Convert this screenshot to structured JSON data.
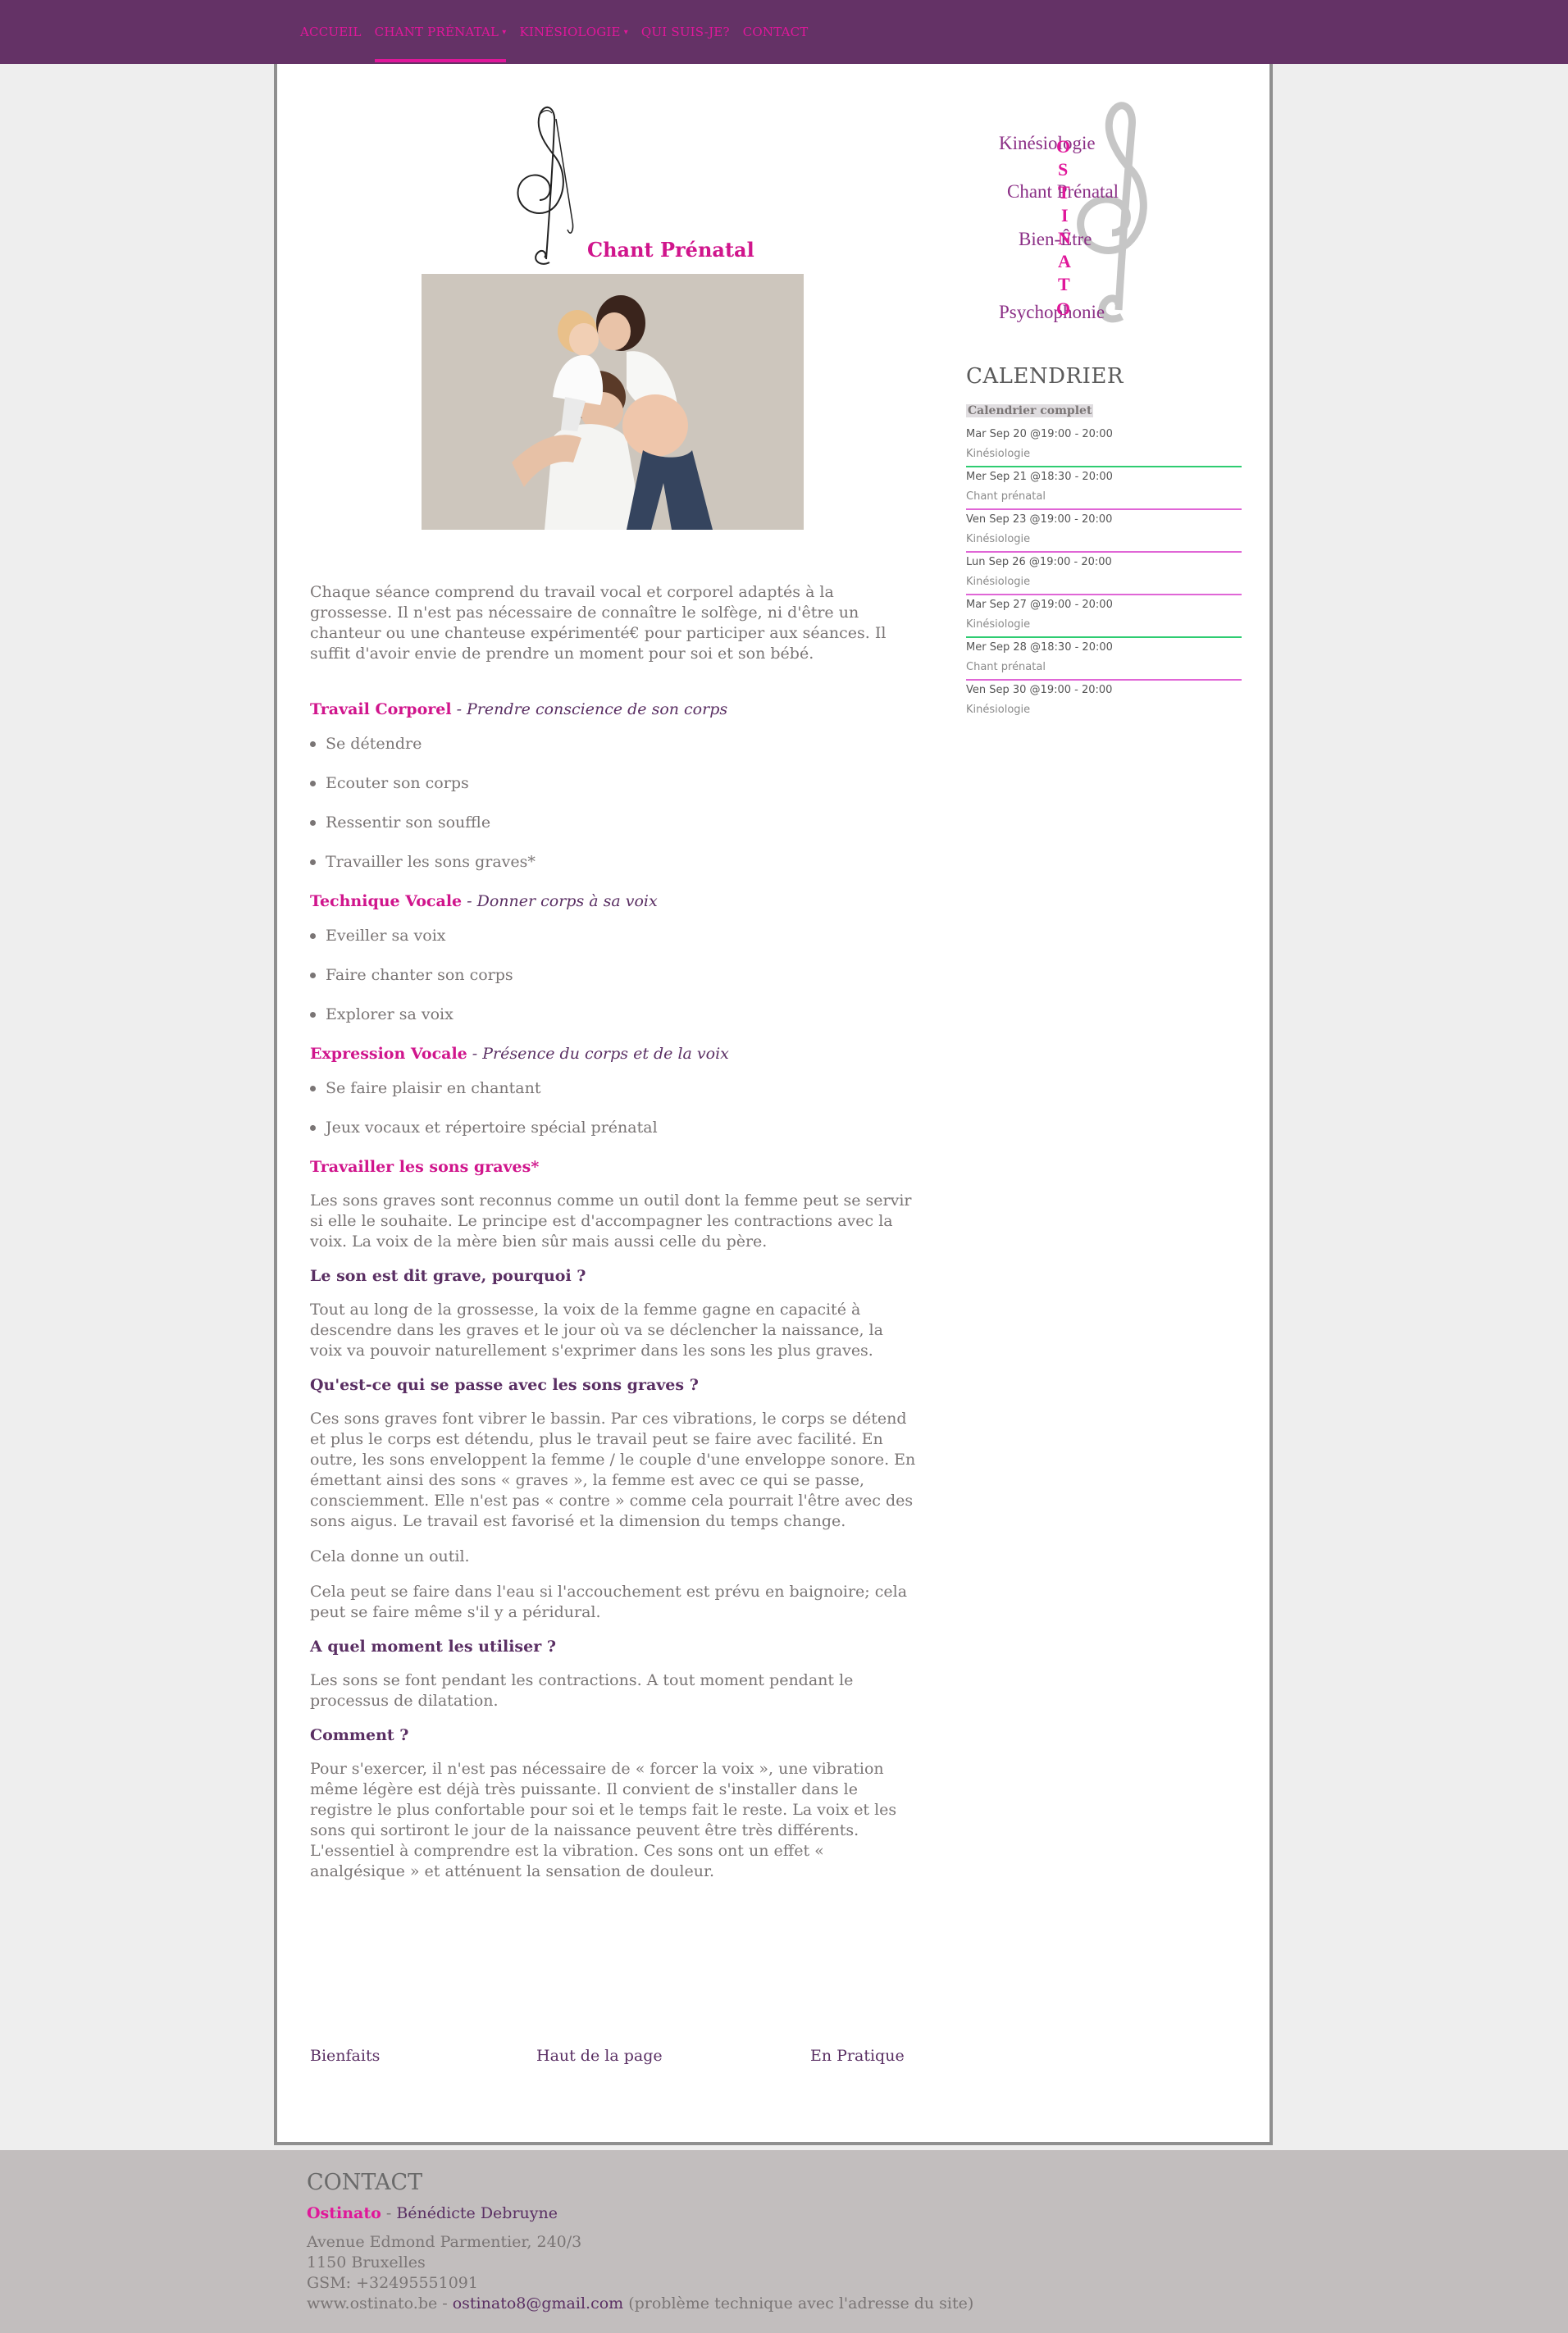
{
  "nav": {
    "items": [
      {
        "label": "Accueil"
      },
      {
        "label": "Chant Prénatal"
      },
      {
        "label": "Kinésiologie"
      },
      {
        "label": "Qui suis-je?"
      },
      {
        "label": "Contact"
      }
    ]
  },
  "hero": {
    "title": "Chant Prénatal"
  },
  "intro": "Chaque séance comprend du travail vocal et corporel adaptés à la grossesse. Il n'est pas nécessaire de connaître le solfège, ni d'être un chanteur ou une chanteuse expérimenté€ pour participer aux séances. Il suffit d'avoir envie de prendre un moment pour soi et son bébé.",
  "sections": [
    {
      "title": "Travail Corporel",
      "subtitle": " - Prendre conscience de son corps",
      "items": [
        "Se détendre",
        "Ecouter son corps",
        "Ressentir son souffle",
        "Travailler les sons graves*"
      ]
    },
    {
      "title": "Technique Vocale",
      "subtitle": " - Donner corps à sa voix",
      "items": [
        "Eveiller sa voix",
        "Faire chanter son corps",
        "Explorer sa voix"
      ]
    },
    {
      "title": "Expression Vocale",
      "subtitle": " - Présence du corps et de la voix",
      "items": [
        "Se faire plaisir en chantant",
        "Jeux vocaux et répertoire spécial prénatal"
      ]
    }
  ],
  "graves": {
    "title": "Travailler les sons graves*",
    "p1": "Les sons graves sont reconnus comme un outil dont la femme peut se servir si elle le souhaite. Le principe est d'accompagner les contractions avec la voix. La voix de la mère bien sûr mais aussi celle du père.",
    "q1": "Le son est dit grave, pourquoi ?",
    "p2": "Tout au long de la grossesse, la voix de la femme gagne en capacité à descendre dans les graves et le jour où va se déclencher la naissance, la voix va pouvoir naturellement s'exprimer dans les sons les plus graves.",
    "q2": "Qu'est-ce qui se passe avec les sons graves ?",
    "p3": "Ces sons graves font vibrer le bassin. Par ces vibrations, le corps se détend et plus le corps est détendu, plus le travail peut se faire avec facilité. En outre, les sons enveloppent la femme / le couple d'une enveloppe sonore. En émettant ainsi des sons « graves », la femme est avec ce qui se passe, consciemment. Elle n'est pas « contre » comme cela pourrait l'être avec des sons aigus. Le travail est favorisé et la dimension du temps change.",
    "p4": "Cela donne un outil.",
    "p5": "Cela peut se faire dans l'eau si l'accouchement est prévu en baignoire; cela peut se faire même s'il y a péridural.",
    "q3": "A quel moment les utiliser ?",
    "p6": "Les sons se font pendant les contractions. A tout moment pendant le processus de dilatation.",
    "q4": "Comment ?",
    "p7": "Pour s'exercer, il n'est pas nécessaire de « forcer la voix », une vibration même légère est déjà très puissante. Il convient de s'installer dans le registre le plus confortable pour soi et le temps fait le reste. La voix et les sons qui sortiront le jour de la naissance peuvent être très différents. L'essentiel à comprendre est la vibration. Ces sons ont un effet « analgésique » et atténuent la sensation de douleur."
  },
  "footer_nav": {
    "prev": "Bienfaits",
    "top": "Haut de la page",
    "next": "En Pratique"
  },
  "side_logo": {
    "words": [
      "Kinésiologie",
      "Chant Prénatal",
      "Bien-Être",
      "Psychophonie"
    ],
    "vertical": "OSTINATO"
  },
  "calendar": {
    "title": "CALENDRIER",
    "full_link": "Calendrier complet",
    "events": [
      {
        "when": "Mar Sep 20 @19:00 - 20:00",
        "what": "Kinésiologie",
        "color": "#2ecc71"
      },
      {
        "when": "Mer Sep 21 @18:30 - 20:00",
        "what": "Chant prénatal",
        "color": "#e066d6"
      },
      {
        "when": "Ven Sep 23 @19:00 - 20:00",
        "what": "Kinésiologie",
        "color": "#e066d6"
      },
      {
        "when": "Lun Sep 26 @19:00 - 20:00",
        "what": "Kinésiologie",
        "color": "#e066d6"
      },
      {
        "when": "Mar Sep 27 @19:00 - 20:00",
        "what": "Kinésiologie",
        "color": "#2ecc71"
      },
      {
        "when": "Mer Sep 28 @18:30 - 20:00",
        "what": "Chant prénatal",
        "color": "#e066d6"
      },
      {
        "when": "Ven Sep 30 @19:00 - 20:00",
        "what": "Kinésiologie",
        "color": "#ffffff"
      }
    ]
  },
  "contact": {
    "title": "CONTACT",
    "brand": "Ostinato",
    "sep": " - ",
    "name": "Bénédicte Debruyne",
    "address1": "Avenue Edmond Parmentier, 240/3",
    "address2": "1150 Bruxelles",
    "phone": "GSM: +32495551091",
    "site": " www.ostinato.be - ",
    "email": "ostinato8@gmail.com",
    "note": " (problème technique avec l'adresse du site)"
  },
  "colors": {
    "topbar": "#643266",
    "accent": "#e0179a",
    "heading": "#5a2f63"
  }
}
